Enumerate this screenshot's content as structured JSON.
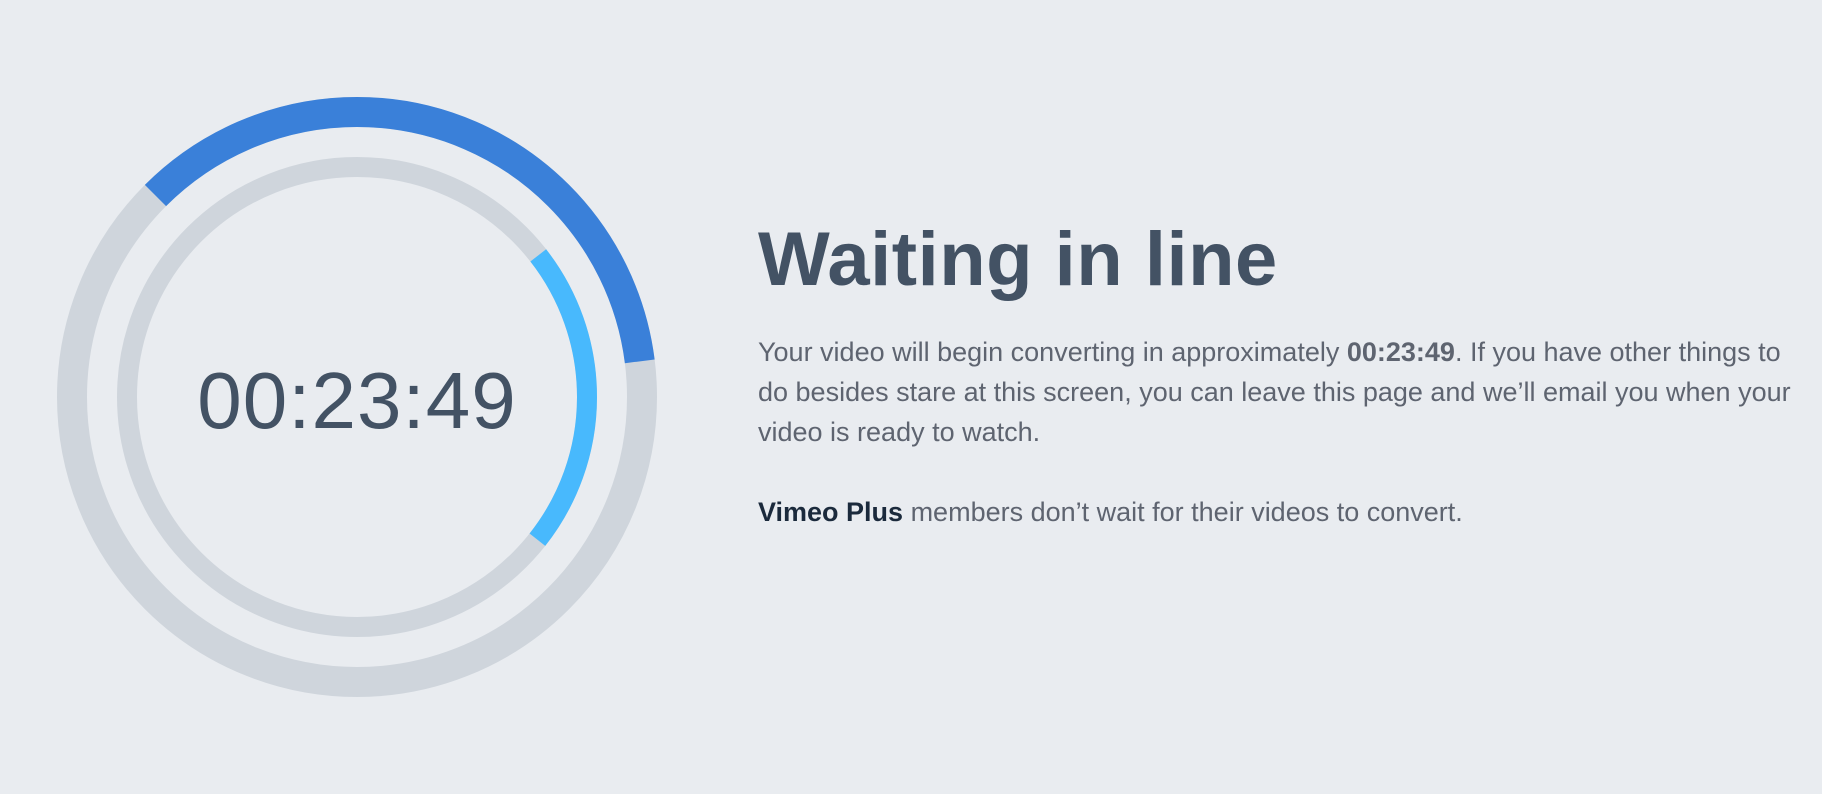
{
  "timer": {
    "countdown": "00:23:49",
    "outer_progress": 0.355,
    "inner_progress": 0.212
  },
  "colors": {
    "background": "#e9ecf0",
    "track": "#cfd5dc",
    "outer_progress": "#3a80d9",
    "inner_progress": "#48b9fd",
    "text_dark": "#435264",
    "text_body": "#5e6470",
    "brand_text": "#1b2a3c"
  },
  "message": {
    "title": "Waiting in line",
    "body_prefix": "Your video will begin converting in approximately ",
    "body_time": "00:23:49",
    "body_suffix": ". If you have other things to do besides stare at this screen, you can leave this page and we’ll email you when your video is ready to watch.",
    "plus_brand": "Vimeo Plus",
    "plus_text": " members don’t wait for their videos to convert."
  }
}
